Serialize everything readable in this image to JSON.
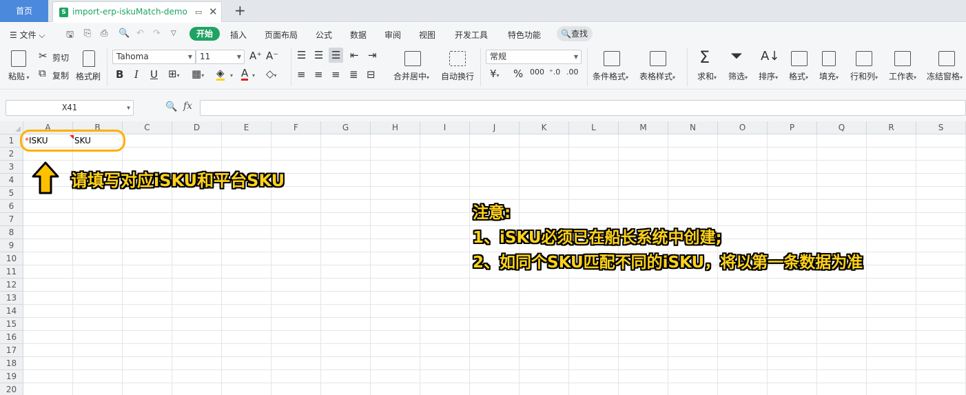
{
  "tabs": {
    "home_label": "首页",
    "doc_icon_letter": "S",
    "doc_title": "import-erp-iskuMatch-demo",
    "new_tab": "+"
  },
  "menu": {
    "file_label": "文件",
    "start_label": "开始",
    "items": [
      "插入",
      "页面布局",
      "公式",
      "数据",
      "审阅",
      "视图",
      "开发工具",
      "特色功能"
    ],
    "search_label": "查找"
  },
  "ribbon": {
    "paste": "粘贴",
    "cut": "剪切",
    "copy": "复制",
    "format_painter": "格式刷",
    "font_name": "Tahoma",
    "font_size": "11",
    "number_format": "常规",
    "merge_center": "合并居中",
    "wrap_text": "自动换行",
    "conditional_format": "条件格式",
    "table_style": "表格样式",
    "sum": "求和",
    "filter": "筛选",
    "sort": "排序",
    "format": "格式",
    "fill": "填充",
    "row_col": "行和列",
    "worksheet": "工作表",
    "freeze": "冻结窗格"
  },
  "formula_bar": {
    "name_box": "X41",
    "fx": "fx",
    "value": ""
  },
  "columns": [
    "A",
    "B",
    "C",
    "D",
    "E",
    "F",
    "G",
    "H",
    "I",
    "J",
    "K",
    "L",
    "M",
    "N",
    "O",
    "P",
    "Q",
    "R",
    "S"
  ],
  "rows": [
    "1",
    "2",
    "3",
    "4",
    "5",
    "6",
    "7",
    "8",
    "9",
    "10",
    "11",
    "12",
    "13",
    "14",
    "15",
    "16",
    "17",
    "18",
    "19",
    "20"
  ],
  "cells": {
    "A1_required_mark": "*",
    "A1": "ISKU",
    "B1": "SKU"
  },
  "annotations": {
    "fill_hint": "请填写对应iSKU和平台SKU",
    "note_title": "注意:",
    "note_line1": "1、iSKU必须已在船长系统中创建;",
    "note_line2": "2、如同个SKU匹配不同的iSKU，将以第一条数据为准"
  },
  "colors": {
    "accent_green": "#1ea363",
    "highlight_orange": "#ffb000",
    "annotation_yellow": "#ffd21a"
  }
}
